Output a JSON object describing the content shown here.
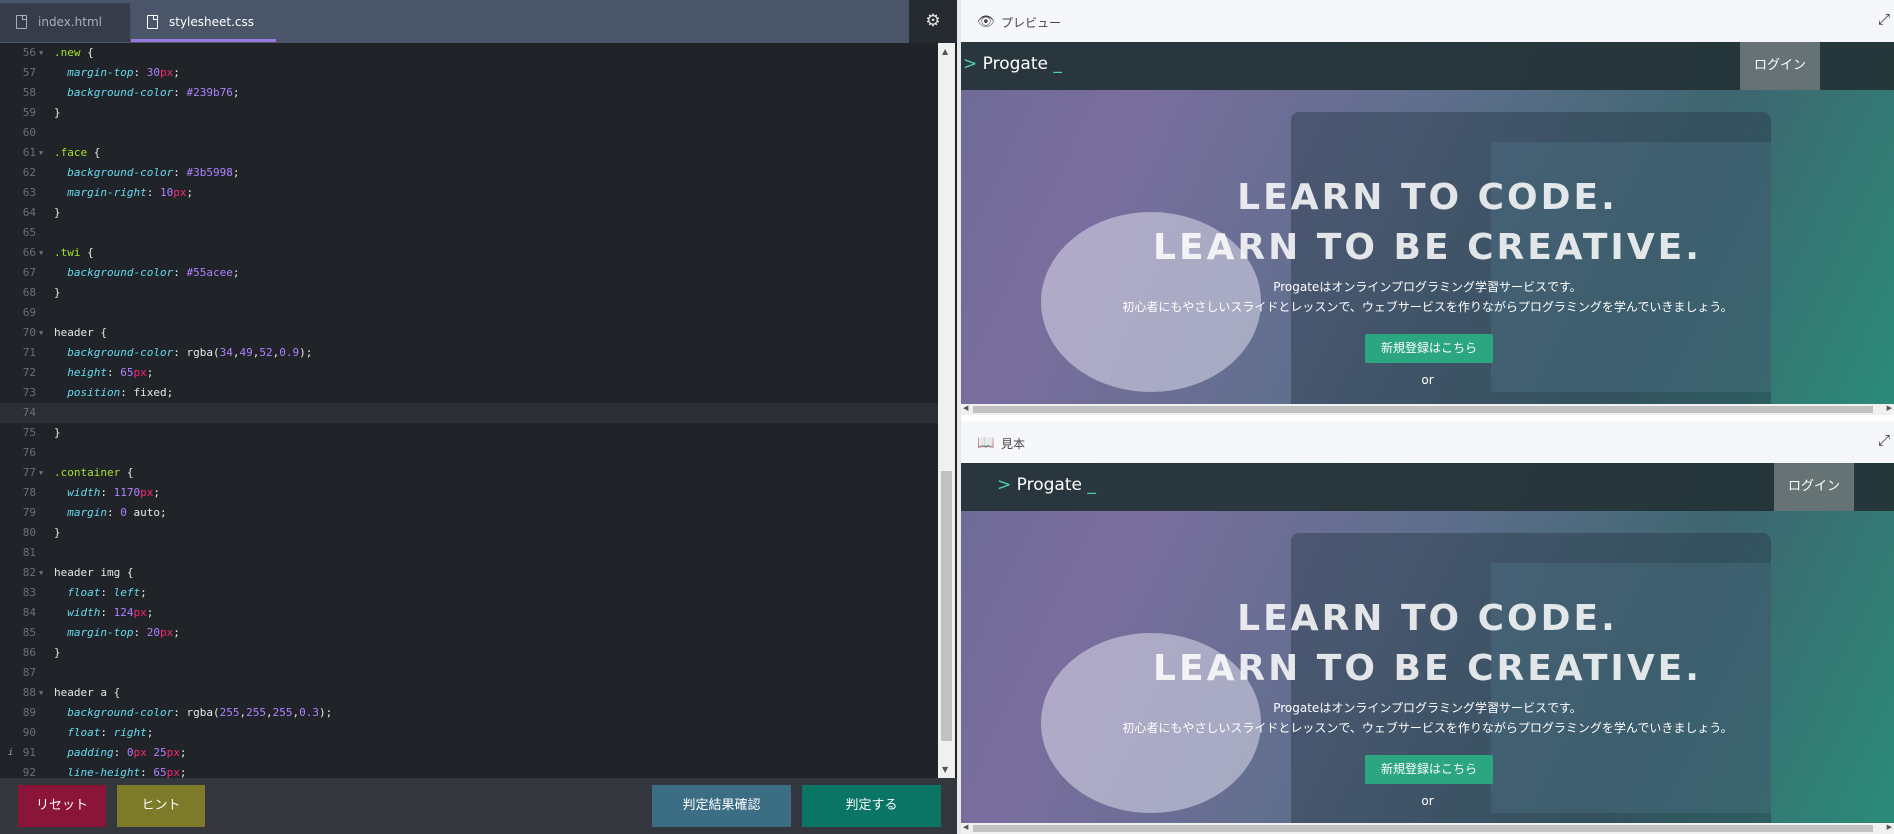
{
  "tabs": [
    {
      "label": "index.html",
      "active": false
    },
    {
      "label": "stylesheet.css",
      "active": true
    }
  ],
  "settings_icon": "gear-icon",
  "code_lines": [
    {
      "n": "56",
      "fold": true,
      "parts": [
        [
          ".new",
          "sel"
        ],
        [
          " {",
          "val"
        ]
      ]
    },
    {
      "n": "57",
      "fold": false,
      "parts": [
        [
          "  ",
          "val"
        ],
        [
          "margin-top",
          "prop"
        ],
        [
          ": ",
          "val"
        ],
        [
          "30",
          "num"
        ],
        [
          "px",
          "unit"
        ],
        [
          ";",
          "val"
        ]
      ]
    },
    {
      "n": "58",
      "fold": false,
      "parts": [
        [
          "  ",
          "val"
        ],
        [
          "background-color",
          "prop"
        ],
        [
          ": ",
          "val"
        ],
        [
          "#239b76",
          "num"
        ],
        [
          ";",
          "val"
        ]
      ]
    },
    {
      "n": "59",
      "fold": false,
      "parts": [
        [
          "}",
          "val"
        ]
      ]
    },
    {
      "n": "60",
      "fold": false,
      "parts": []
    },
    {
      "n": "61",
      "fold": true,
      "parts": [
        [
          ".face",
          "sel"
        ],
        [
          " {",
          "val"
        ]
      ]
    },
    {
      "n": "62",
      "fold": false,
      "parts": [
        [
          "  ",
          "val"
        ],
        [
          "background-color",
          "prop"
        ],
        [
          ": ",
          "val"
        ],
        [
          "#3b5998",
          "num"
        ],
        [
          ";",
          "val"
        ]
      ]
    },
    {
      "n": "63",
      "fold": false,
      "parts": [
        [
          "  ",
          "val"
        ],
        [
          "margin-right",
          "prop"
        ],
        [
          ": ",
          "val"
        ],
        [
          "10",
          "num"
        ],
        [
          "px",
          "unit"
        ],
        [
          ";",
          "val"
        ]
      ]
    },
    {
      "n": "64",
      "fold": false,
      "parts": [
        [
          "}",
          "val"
        ]
      ]
    },
    {
      "n": "65",
      "fold": false,
      "parts": []
    },
    {
      "n": "66",
      "fold": true,
      "parts": [
        [
          ".twi",
          "sel"
        ],
        [
          " {",
          "val"
        ]
      ]
    },
    {
      "n": "67",
      "fold": false,
      "parts": [
        [
          "  ",
          "val"
        ],
        [
          "background-color",
          "prop"
        ],
        [
          ": ",
          "val"
        ],
        [
          "#55acee",
          "num"
        ],
        [
          ";",
          "val"
        ]
      ]
    },
    {
      "n": "68",
      "fold": false,
      "parts": [
        [
          "}",
          "val"
        ]
      ]
    },
    {
      "n": "69",
      "fold": false,
      "parts": []
    },
    {
      "n": "70",
      "fold": true,
      "parts": [
        [
          "header",
          "val"
        ],
        [
          " {",
          "val"
        ]
      ]
    },
    {
      "n": "71",
      "fold": false,
      "parts": [
        [
          "  ",
          "val"
        ],
        [
          "background-color",
          "prop"
        ],
        [
          ": ",
          "val"
        ],
        [
          "rgba(",
          "val"
        ],
        [
          "34",
          "num"
        ],
        [
          ",",
          "val"
        ],
        [
          "49",
          "num"
        ],
        [
          ",",
          "val"
        ],
        [
          "52",
          "num"
        ],
        [
          ",",
          "val"
        ],
        [
          "0.9",
          "num"
        ],
        [
          ");",
          "val"
        ]
      ]
    },
    {
      "n": "72",
      "fold": false,
      "parts": [
        [
          "  ",
          "val"
        ],
        [
          "height",
          "prop"
        ],
        [
          ": ",
          "val"
        ],
        [
          "65",
          "num"
        ],
        [
          "px",
          "unit"
        ],
        [
          ";",
          "val"
        ]
      ]
    },
    {
      "n": "73",
      "fold": false,
      "parts": [
        [
          "  ",
          "val"
        ],
        [
          "position",
          "prop"
        ],
        [
          ": ",
          "val"
        ],
        [
          "fixed",
          "val"
        ],
        [
          ";",
          "val"
        ]
      ]
    },
    {
      "n": "74",
      "fold": false,
      "current": true,
      "parts": []
    },
    {
      "n": "75",
      "fold": false,
      "parts": [
        [
          "}",
          "val"
        ]
      ]
    },
    {
      "n": "76",
      "fold": false,
      "parts": []
    },
    {
      "n": "77",
      "fold": true,
      "parts": [
        [
          ".container",
          "sel"
        ],
        [
          " {",
          "val"
        ]
      ]
    },
    {
      "n": "78",
      "fold": false,
      "parts": [
        [
          "  ",
          "val"
        ],
        [
          "width",
          "prop"
        ],
        [
          ": ",
          "val"
        ],
        [
          "1170",
          "num"
        ],
        [
          "px",
          "unit"
        ],
        [
          ";",
          "val"
        ]
      ]
    },
    {
      "n": "79",
      "fold": false,
      "parts": [
        [
          "  ",
          "val"
        ],
        [
          "margin",
          "prop"
        ],
        [
          ": ",
          "val"
        ],
        [
          "0",
          "num"
        ],
        [
          " auto;",
          "val"
        ]
      ]
    },
    {
      "n": "80",
      "fold": false,
      "parts": [
        [
          "}",
          "val"
        ]
      ]
    },
    {
      "n": "81",
      "fold": false,
      "parts": []
    },
    {
      "n": "82",
      "fold": true,
      "parts": [
        [
          "header img",
          "val"
        ],
        [
          " {",
          "val"
        ]
      ]
    },
    {
      "n": "83",
      "fold": false,
      "parts": [
        [
          "  ",
          "val"
        ],
        [
          "float",
          "prop"
        ],
        [
          ": ",
          "val"
        ],
        [
          "left",
          "prop"
        ],
        [
          ";",
          "val"
        ]
      ]
    },
    {
      "n": "84",
      "fold": false,
      "parts": [
        [
          "  ",
          "val"
        ],
        [
          "width",
          "prop"
        ],
        [
          ": ",
          "val"
        ],
        [
          "124",
          "num"
        ],
        [
          "px",
          "unit"
        ],
        [
          ";",
          "val"
        ]
      ]
    },
    {
      "n": "85",
      "fold": false,
      "parts": [
        [
          "  ",
          "val"
        ],
        [
          "margin-top",
          "prop"
        ],
        [
          ": ",
          "val"
        ],
        [
          "20",
          "num"
        ],
        [
          "px",
          "unit"
        ],
        [
          ";",
          "val"
        ]
      ]
    },
    {
      "n": "86",
      "fold": false,
      "parts": [
        [
          "}",
          "val"
        ]
      ]
    },
    {
      "n": "87",
      "fold": false,
      "parts": []
    },
    {
      "n": "88",
      "fold": true,
      "parts": [
        [
          "header a",
          "val"
        ],
        [
          " {",
          "val"
        ]
      ]
    },
    {
      "n": "89",
      "fold": false,
      "parts": [
        [
          "  ",
          "val"
        ],
        [
          "background-color",
          "prop"
        ],
        [
          ": ",
          "val"
        ],
        [
          "rgba(",
          "val"
        ],
        [
          "255",
          "num"
        ],
        [
          ",",
          "val"
        ],
        [
          "255",
          "num"
        ],
        [
          ",",
          "val"
        ],
        [
          "255",
          "num"
        ],
        [
          ",",
          "val"
        ],
        [
          "0.3",
          "num"
        ],
        [
          ");",
          "val"
        ]
      ]
    },
    {
      "n": "90",
      "fold": false,
      "parts": [
        [
          "  ",
          "val"
        ],
        [
          "float",
          "prop"
        ],
        [
          ": ",
          "val"
        ],
        [
          "right",
          "prop"
        ],
        [
          ";",
          "val"
        ]
      ]
    },
    {
      "n": "91",
      "fold": false,
      "info": true,
      "parts": [
        [
          "  ",
          "val"
        ],
        [
          "padding",
          "prop"
        ],
        [
          ": ",
          "val"
        ],
        [
          "0",
          "num"
        ],
        [
          "px",
          "unit"
        ],
        [
          " ",
          "val"
        ],
        [
          "25",
          "num"
        ],
        [
          "px",
          "unit"
        ],
        [
          ";",
          "val"
        ]
      ]
    },
    {
      "n": "92",
      "fold": false,
      "parts": [
        [
          "  ",
          "val"
        ],
        [
          "line-height",
          "prop"
        ],
        [
          ": ",
          "val"
        ],
        [
          "65",
          "num"
        ],
        [
          "px",
          "unit"
        ],
        [
          ";",
          "val"
        ]
      ]
    }
  ],
  "footer": {
    "reset": "リセット",
    "hint": "ヒント",
    "check_result": "判定結果確認",
    "judge": "判定する"
  },
  "panes": {
    "preview": {
      "title": "プレビュー",
      "icon": "eye-icon"
    },
    "sample": {
      "title": "見本",
      "icon": "book-icon"
    }
  },
  "site": {
    "logo": "Progate",
    "logo_mark_left": ">",
    "logo_mark_right": "_",
    "login": "ログイン",
    "headline1": "LEARN TO CODE.",
    "headline2": "LEARN TO BE CREATIVE.",
    "desc1": "Progateはオンラインプログラミング学習サービスです。",
    "desc2": "初心者にもやさしいスライドとレッスンで、ウェブサービスを作りながらプログラミングを学んでいきましょう。",
    "signup": "新規登録はこちら",
    "or": "or"
  },
  "colors": {
    "reset_button": "#8b1538",
    "hint_button": "#7d7a2a",
    "check_button": "#3b6d85",
    "judge_button": "#0a7565",
    "signup_button": "#2ca581",
    "tab_active_underline": "#9b7be0"
  }
}
